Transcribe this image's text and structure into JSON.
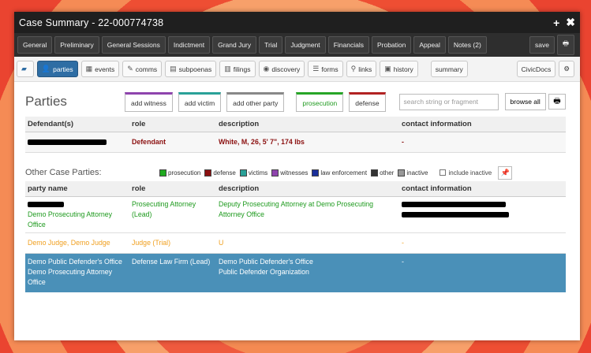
{
  "window": {
    "title": "Case Summary - 22-000774738",
    "add_icon": "+",
    "close_icon": "✖"
  },
  "tabs": [
    "General",
    "Preliminary",
    "General Sessions",
    "Indictment",
    "Grand Jury",
    "Trial",
    "Judgment",
    "Financials",
    "Probation",
    "Appeal",
    "Notes (2)"
  ],
  "tab_actions": {
    "save": "save",
    "print_icon": "print-icon"
  },
  "toolbar": {
    "items": [
      {
        "label": "parties",
        "icon": "person-icon",
        "active": true
      },
      {
        "label": "events",
        "icon": "calendar-icon"
      },
      {
        "label": "comms",
        "icon": "pencil-icon"
      },
      {
        "label": "subpoenas",
        "icon": "subpoena-icon"
      },
      {
        "label": "filings",
        "icon": "filings-icon"
      },
      {
        "label": "discovery",
        "icon": "eye-icon"
      },
      {
        "label": "forms",
        "icon": "list-icon"
      },
      {
        "label": "links",
        "icon": "link-icon"
      },
      {
        "label": "history",
        "icon": "book-icon"
      }
    ],
    "summary": "summary",
    "civicdocs": "CivicDocs"
  },
  "parties": {
    "heading": "Parties",
    "buttons": [
      "add witness",
      "add victim",
      "add other party"
    ],
    "filters": [
      "prosecution",
      "defense"
    ],
    "search_placeholder": "search string or fragment",
    "browse": "browse all",
    "defendant_headers": [
      "Defendant(s)",
      "role",
      "description",
      "contact information"
    ],
    "defendant": {
      "role": "Defendant",
      "description": "White, M, 26, 5' 7\", 174 lbs",
      "contact": "-"
    }
  },
  "other": {
    "heading": "Other Case Parties:",
    "legend": [
      {
        "label": "prosecution",
        "color": "#1faa1f"
      },
      {
        "label": "defense",
        "color": "#8b1010"
      },
      {
        "label": "victims",
        "color": "#2aa198"
      },
      {
        "label": "witnesses",
        "color": "#8e44ad"
      },
      {
        "label": "law enforcement",
        "color": "#1a2f9a"
      },
      {
        "label": "other",
        "color": "#333333"
      },
      {
        "label": "inactive",
        "color": "#999999"
      }
    ],
    "include_inactive": "include inactive",
    "headers": [
      "party name",
      "role",
      "description",
      "contact information"
    ],
    "rows": [
      {
        "name_line2": "Demo Prosecuting Attorney Office",
        "role": "Prosecuting Attorney (Lead)",
        "description": "Deputy Prosecuting Attorney at Demo Prosecuting Attorney Office"
      },
      {
        "name": "Demo Judge, Demo Judge",
        "role": "Judge (Trial)",
        "description": "U",
        "contact": "-"
      },
      {
        "name": "Demo Public Defender's Office",
        "name2": "Demo Prosecuting Attorney Office",
        "role": "Defense Law Firm (Lead)",
        "description": "Demo Public Defender's Office",
        "description2": "Public Defender Organization",
        "contact": "-"
      }
    ]
  }
}
